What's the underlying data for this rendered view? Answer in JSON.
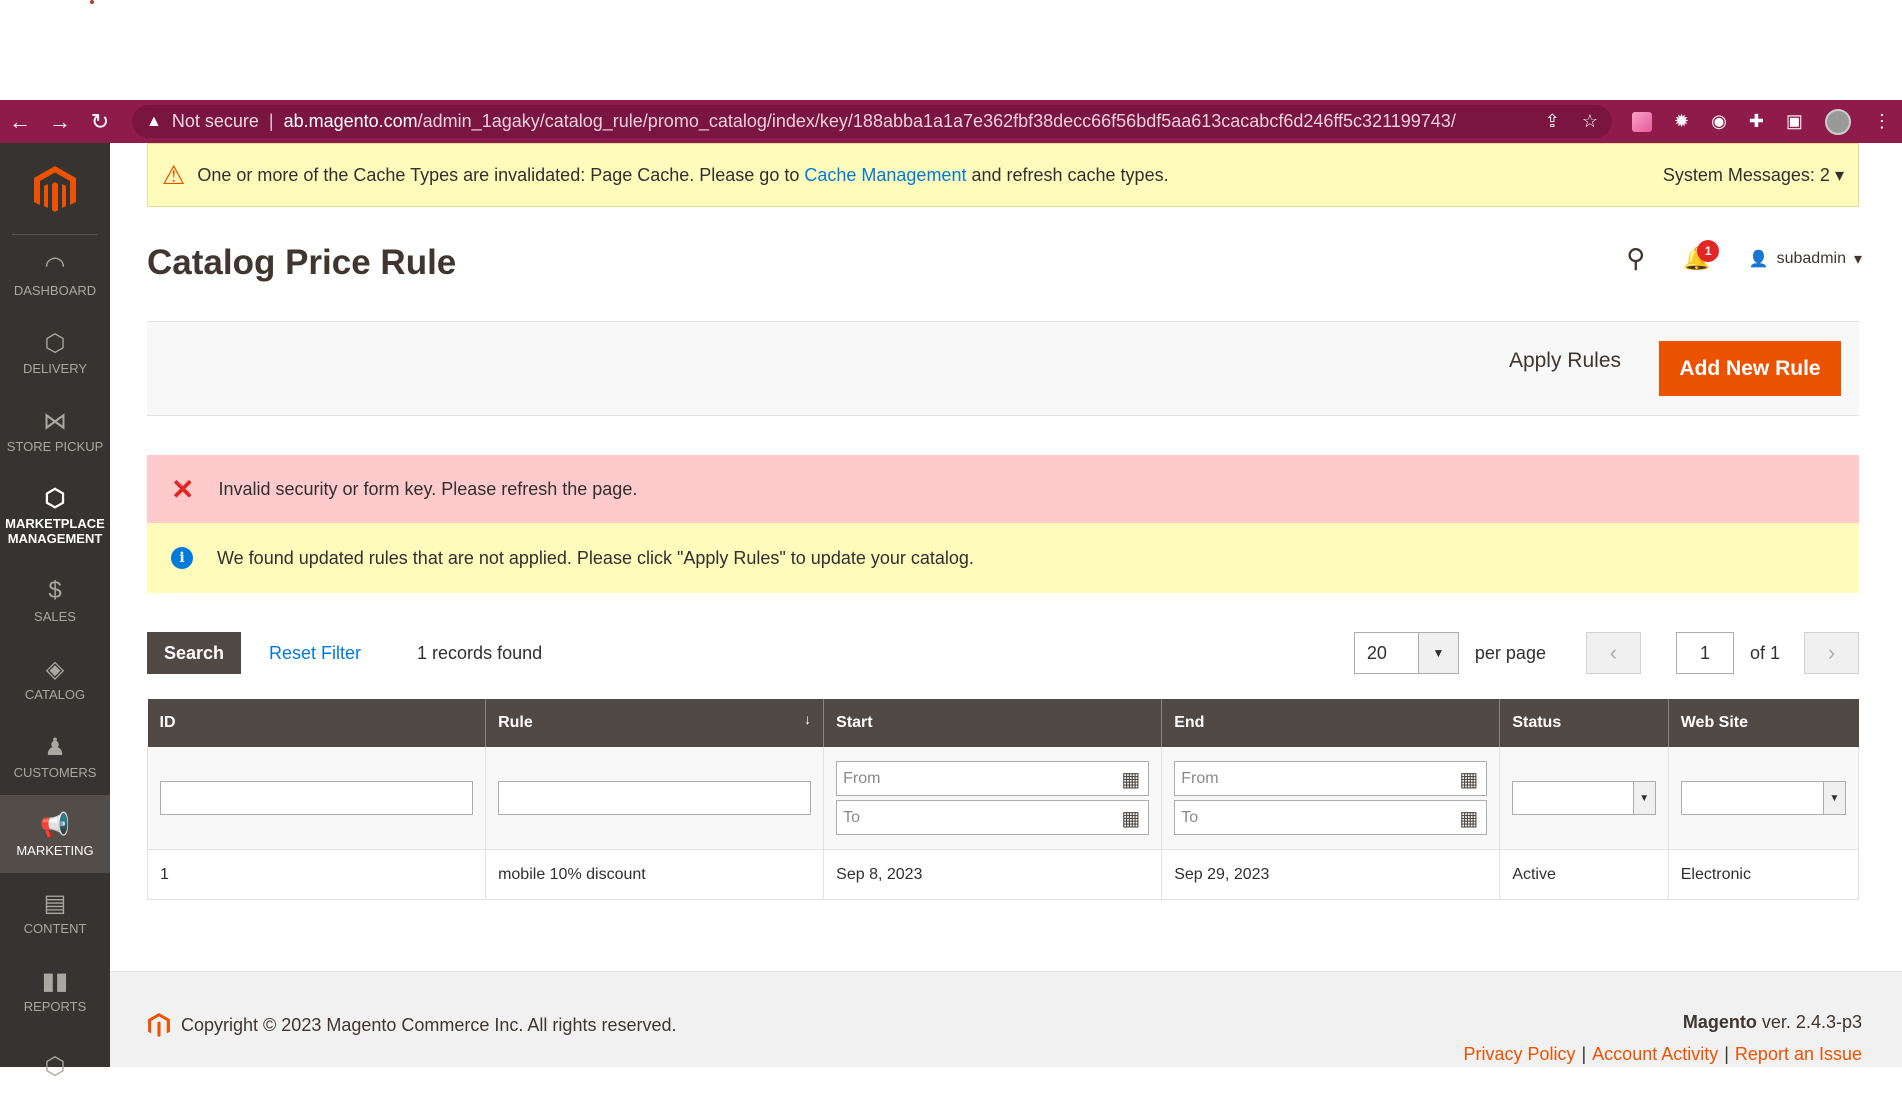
{
  "browser": {
    "security_label": "Not secure",
    "url_host": "ab.magento.com",
    "url_path": "/admin_1agaky/catalog_rule/promo_catalog/index/key/188abba1a1a7e362fbf38decc66f56bdf5aa613cacabcf6d246ff5c321199743/"
  },
  "sidebar": {
    "items": [
      {
        "label": "DASHBOARD",
        "icon": "dashboard-icon"
      },
      {
        "label": "DELIVERY",
        "icon": "hexagon-icon"
      },
      {
        "label": "STORE PICKUP",
        "icon": "store-pickup-icon"
      },
      {
        "label": "MARKETPLACE MANAGEMENT",
        "icon": "hexagon-icon"
      },
      {
        "label": "SALES",
        "icon": "dollar-icon"
      },
      {
        "label": "CATALOG",
        "icon": "box-icon"
      },
      {
        "label": "CUSTOMERS",
        "icon": "person-icon"
      },
      {
        "label": "MARKETING",
        "icon": "megaphone-icon"
      },
      {
        "label": "CONTENT",
        "icon": "layout-icon"
      },
      {
        "label": "REPORTS",
        "icon": "bar-chart-icon"
      }
    ]
  },
  "system_message": {
    "text_before": "One or more of the Cache Types are invalidated: Page Cache. Please go to ",
    "link": "Cache Management",
    "text_after": " and refresh cache types.",
    "count_label": "System Messages: 2"
  },
  "header": {
    "title": "Catalog Price Rule",
    "notification_count": "1",
    "username": "subadmin"
  },
  "actions": {
    "apply_rules": "Apply Rules",
    "add_new_rule": "Add New Rule"
  },
  "messages": {
    "error": "Invalid security or form key. Please refresh the page.",
    "notice": "We found updated rules that are not applied. Please click \"Apply Rules\" to update your catalog."
  },
  "grid": {
    "search_label": "Search",
    "reset_label": "Reset Filter",
    "records_found": "1 records found",
    "per_page_value": "20",
    "per_page_label": "per page",
    "current_page": "1",
    "of_pages": "of 1",
    "columns": [
      "ID",
      "Rule",
      "Start",
      "End",
      "Status",
      "Web Site"
    ],
    "date_from_placeholder": "From",
    "date_to_placeholder": "To",
    "rows": [
      {
        "id": "1",
        "rule": "mobile 10% discount",
        "start": "Sep 8, 2023",
        "end": "Sep 29, 2023",
        "status": "Active",
        "website": "Electronic"
      }
    ]
  },
  "footer": {
    "copyright": "Copyright © 2023 Magento Commerce Inc. All rights reserved.",
    "brand": "Magento",
    "version": " ver. 2.4.3-p3",
    "links": [
      "Privacy Policy",
      "Account Activity",
      "Report an Issue"
    ]
  },
  "colors": {
    "accent": "#eb5202",
    "browser_bar": "#8e1b4a",
    "sidebar": "#373330",
    "grid_header": "#514943"
  }
}
